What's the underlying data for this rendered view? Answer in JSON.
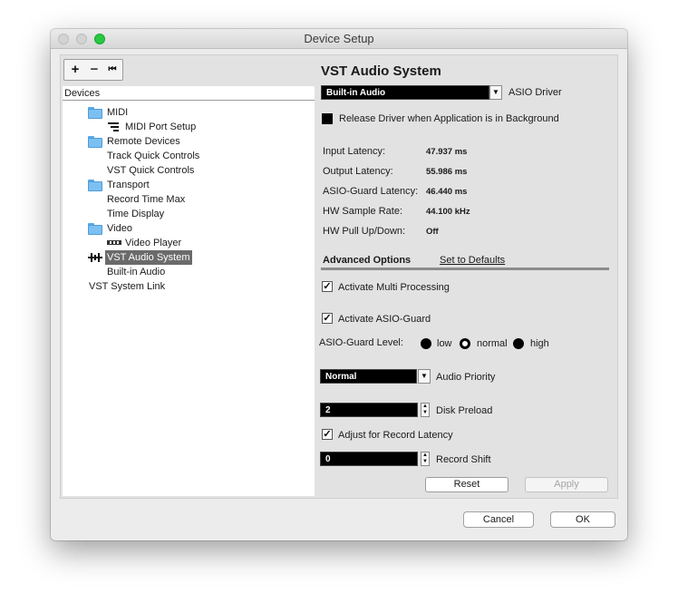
{
  "window": {
    "title": "Device Setup",
    "traffic_lights": [
      "close-icon",
      "minimize-icon",
      "zoom-icon"
    ]
  },
  "toolbar": {
    "add_symbol": "+",
    "remove_symbol": "−",
    "reset_symbol": "⏮"
  },
  "tree": {
    "header": "Devices",
    "items": [
      {
        "label": "MIDI",
        "icon": "folder-icon"
      },
      {
        "label": "MIDI Port Setup",
        "icon": "midi-port-icon"
      },
      {
        "label": "Remote Devices",
        "icon": "folder-icon"
      },
      {
        "label": "Track Quick Controls",
        "icon": ""
      },
      {
        "label": "VST Quick Controls",
        "icon": ""
      },
      {
        "label": "Transport",
        "icon": "folder-icon"
      },
      {
        "label": "Record Time Max",
        "icon": ""
      },
      {
        "label": "Time Display",
        "icon": ""
      },
      {
        "label": "Video",
        "icon": "folder-icon"
      },
      {
        "label": "Video Player",
        "icon": "video-player-icon"
      },
      {
        "label": "VST Audio System",
        "icon": "vst-audio-icon",
        "selected": true
      },
      {
        "label": "Built-in Audio",
        "icon": ""
      },
      {
        "label": "VST System Link",
        "icon": ""
      }
    ]
  },
  "panel": {
    "title": "VST Audio System",
    "driver": {
      "value": "Built-in Audio",
      "label": "ASIO Driver"
    },
    "release_driver": {
      "label": "Release Driver when Application is in Background",
      "checked": false
    },
    "stats": [
      {
        "label": "Input Latency:",
        "value": "47.937 ms"
      },
      {
        "label": "Output Latency:",
        "value": "55.986 ms"
      },
      {
        "label": "ASIO-Guard Latency:",
        "value": "46.440 ms"
      },
      {
        "label": "HW Sample Rate:",
        "value": "44.100 kHz"
      },
      {
        "label": "HW Pull Up/Down:",
        "value": "Off"
      }
    ],
    "advanced_tab": "Advanced Options",
    "set_defaults": "Set to Defaults",
    "multi_processing": {
      "label": "Activate Multi Processing",
      "checked": true
    },
    "asio_guard": {
      "label": "Activate ASIO-Guard",
      "checked": true
    },
    "asio_guard_level": {
      "label": "ASIO-Guard Level:",
      "options": [
        "low",
        "normal",
        "high"
      ],
      "selected": "normal"
    },
    "audio_priority": {
      "value": "Normal",
      "label": "Audio Priority"
    },
    "disk_preload": {
      "value": "2",
      "label": "Disk Preload"
    },
    "record_latency": {
      "label": "Adjust for Record Latency",
      "checked": true
    },
    "record_shift": {
      "value": "0",
      "label": "Record Shift"
    },
    "reset_label": "Reset",
    "apply_label": "Apply",
    "check_glyph": "✓"
  },
  "footer": {
    "cancel_label": "Cancel",
    "ok_label": "OK"
  }
}
